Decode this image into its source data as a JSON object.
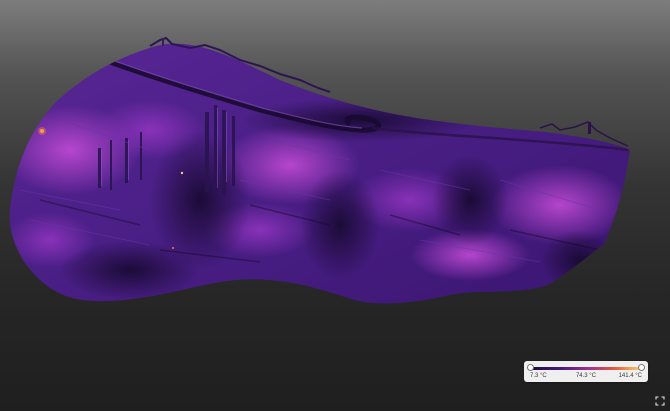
{
  "legend": {
    "min_label": "7.3 °C",
    "mid_label": "74.3 °C",
    "max_label": "141.4 °C",
    "range": [
      7.3,
      141.4
    ],
    "colormap": [
      "#1a0d3b",
      "#4b1a7a",
      "#9b2f8e",
      "#e45a3f",
      "#fbd26a"
    ]
  },
  "colors": {
    "terrain_dark": "#1c0c33",
    "terrain_mid": "#4a1f86",
    "terrain_warm": "#a53ecb",
    "background_top": "#7d7d7d",
    "background_bottom": "#1f1f1f"
  },
  "icons": {
    "fullscreen": "fullscreen-icon"
  }
}
